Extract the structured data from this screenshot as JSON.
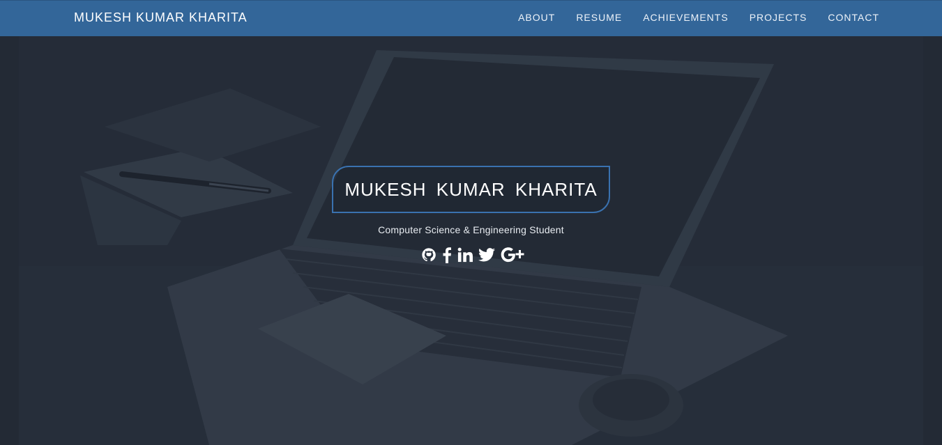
{
  "navbar": {
    "brand": "MUKESH KUMAR KHARITA",
    "links": [
      {
        "label": "ABOUT"
      },
      {
        "label": "RESUME"
      },
      {
        "label": "ACHIEVEMENTS"
      },
      {
        "label": "PROJECTS"
      },
      {
        "label": "CONTACT"
      }
    ]
  },
  "hero": {
    "title": "MUKESH KUMAR KHARITA",
    "subtitle": "Computer Science & Engineering Student",
    "social_icons": [
      "github-icon",
      "facebook-icon",
      "linkedin-icon",
      "twitter-icon",
      "google-plus-icon"
    ]
  },
  "colors": {
    "navbar": "#336699",
    "accent_border": "#3a72b0",
    "hero_overlay": "#27303c"
  }
}
